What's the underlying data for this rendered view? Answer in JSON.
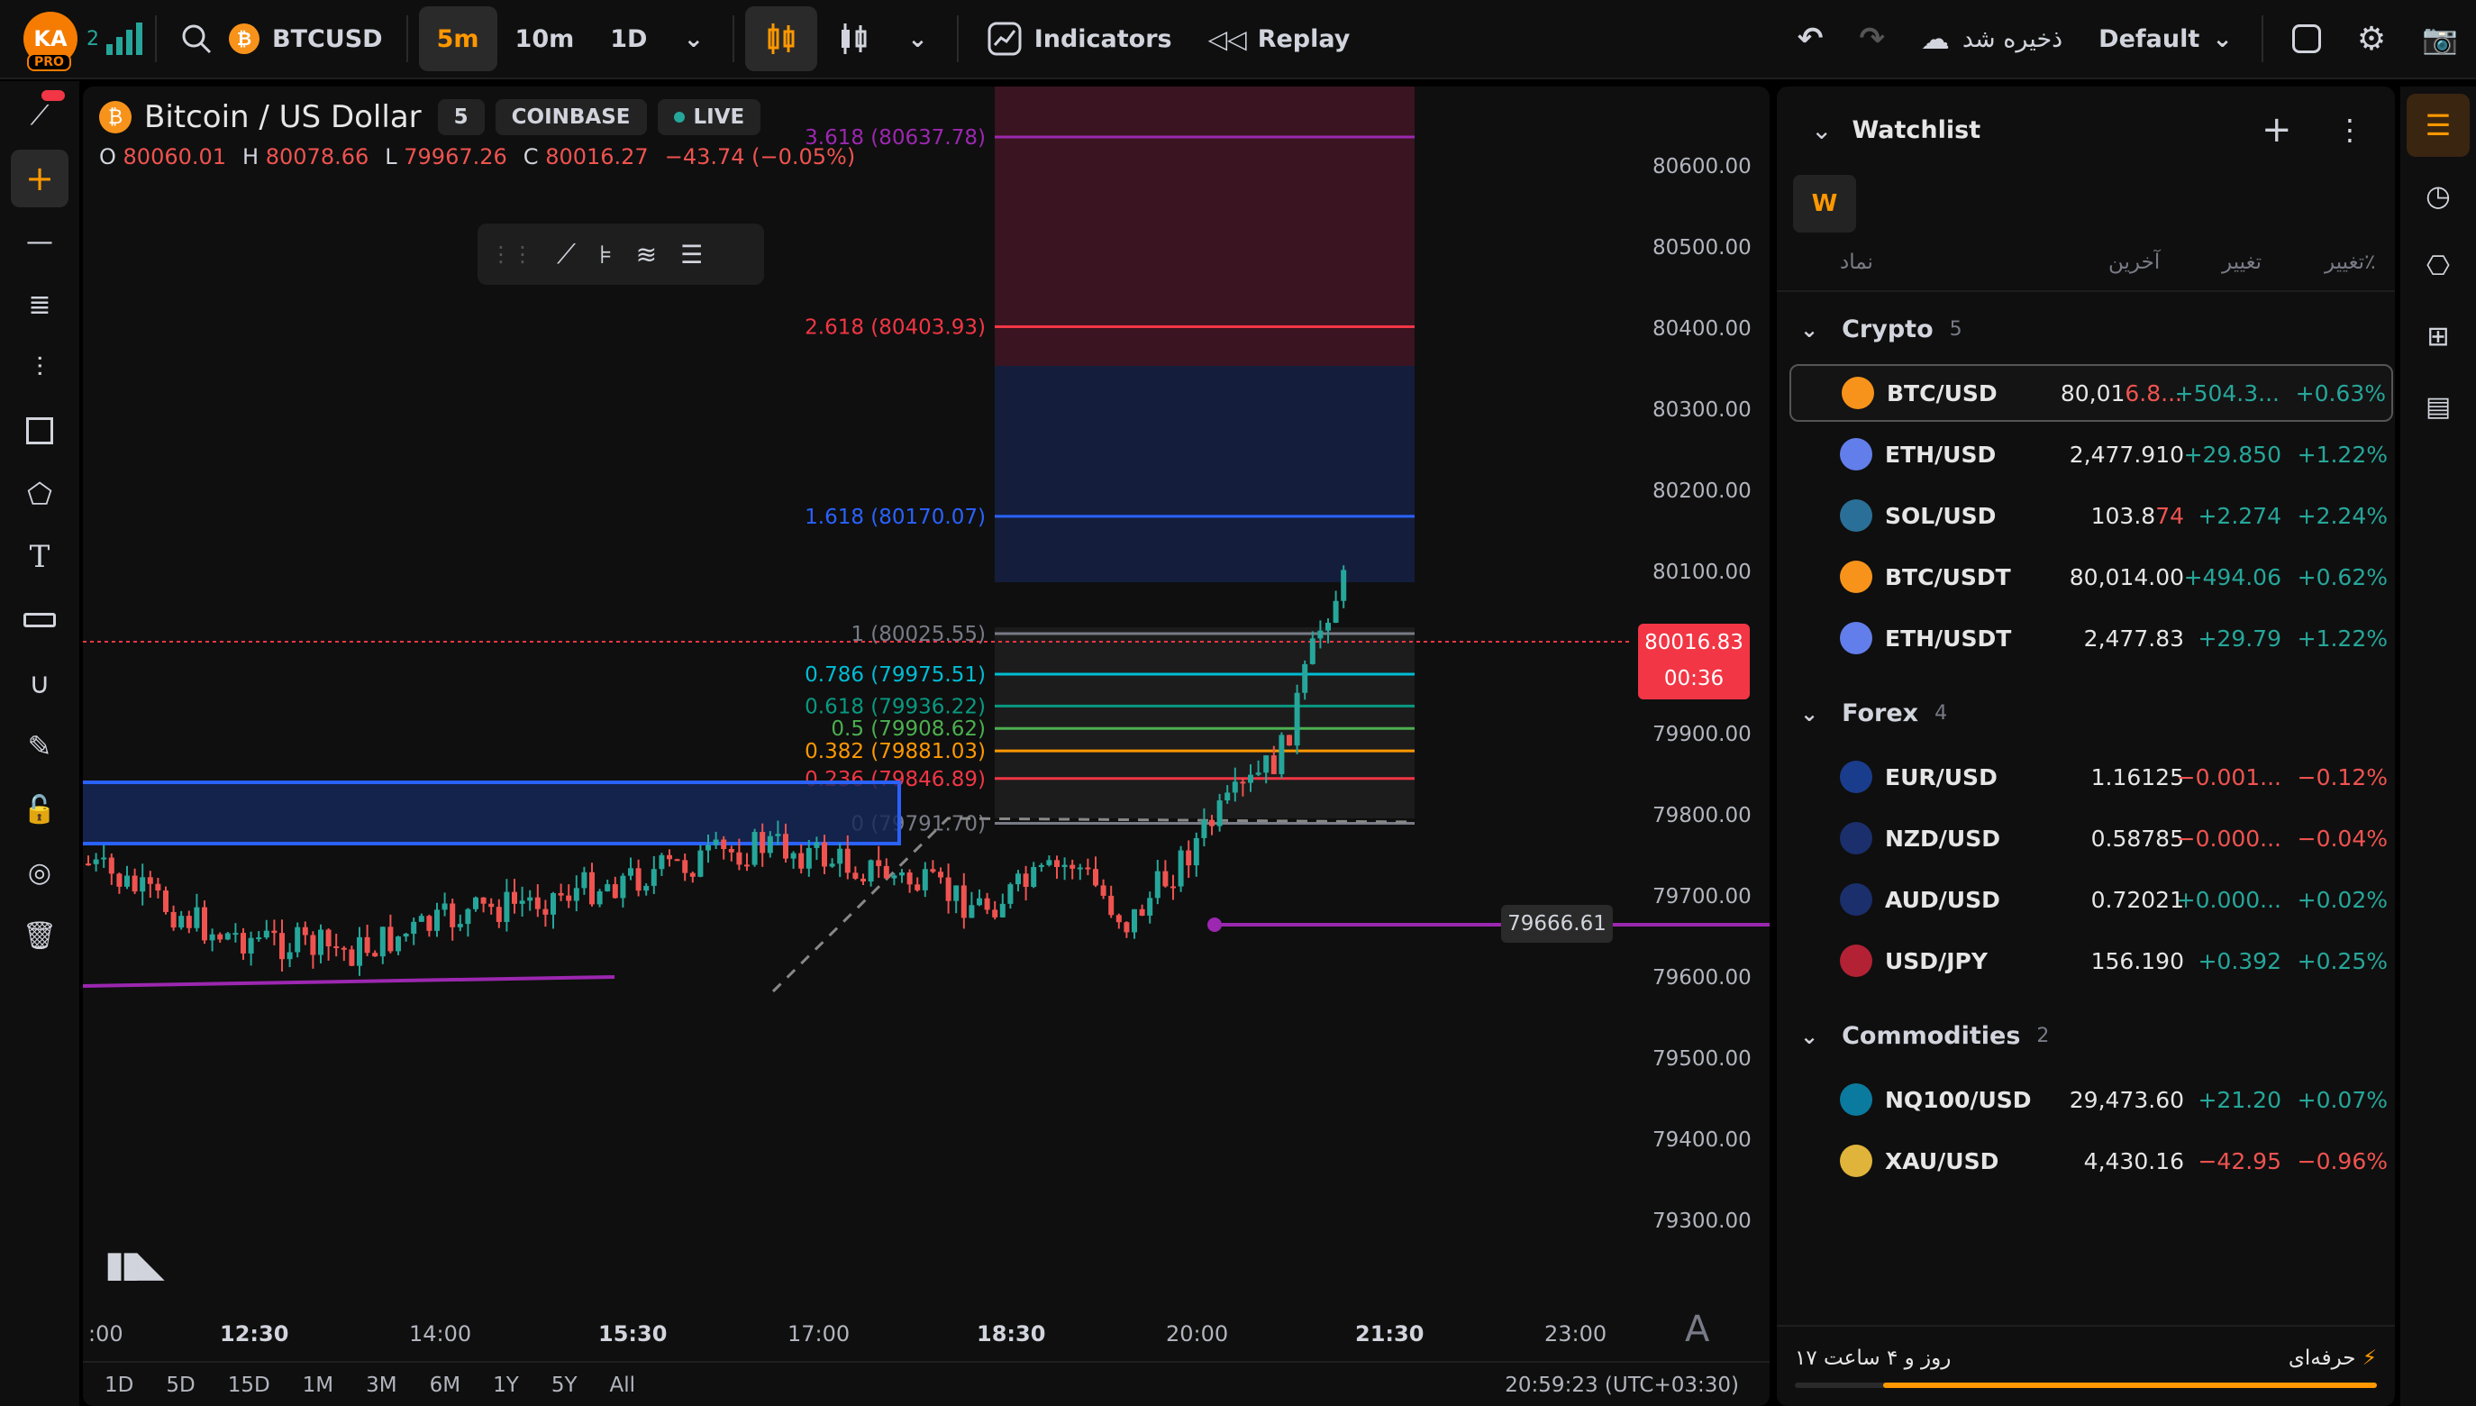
{
  "topbar": {
    "avatar": "KA",
    "avatar_badge": "PRO",
    "signal_count": "2",
    "symbol": "BTCUSD",
    "intervals": [
      "5m",
      "10m",
      "1D"
    ],
    "indicators_label": "Indicators",
    "replay_label": "Replay",
    "saved_label": "ذخیره شد",
    "layout_label": "Default"
  },
  "legend": {
    "title": "Bitcoin / US Dollar",
    "interval": "5",
    "exchange": "COINBASE",
    "live": "LIVE",
    "o_label": "O",
    "o": "80060.01",
    "h_label": "H",
    "h": "80078.66",
    "l_label": "L",
    "l": "79967.26",
    "c_label": "C",
    "c": "80016.27",
    "change": "−43.74 (−0.05%)"
  },
  "price_axis": [
    "80600.00",
    "80500.00",
    "80400.00",
    "80300.00",
    "80200.00",
    "80100.00",
    "79900.00",
    "79800.00",
    "79700.00",
    "79600.00",
    "79500.00",
    "79400.00",
    "79300.00"
  ],
  "time_axis": [
    ":00",
    "12:30",
    "14:00",
    "15:30",
    "17:00",
    "18:30",
    "20:00",
    "21:30",
    "23:00"
  ],
  "last_price": "80016.83",
  "countdown": "00:36",
  "hline_label": "79666.61",
  "fib_levels": [
    {
      "label": "3.618 (80637.78)",
      "color": "#9c27b0"
    },
    {
      "label": "2.618 (80403.93)",
      "color": "#f23645"
    },
    {
      "label": "1.618 (80170.07)",
      "color": "#2962ff"
    },
    {
      "label": "1 (80025.55)",
      "color": "#787b86"
    },
    {
      "label": "0.786 (79975.51)",
      "color": "#00bcd4"
    },
    {
      "label": "0.618 (79936.22)",
      "color": "#089981"
    },
    {
      "label": "0.5 (79908.62)",
      "color": "#4caf50"
    },
    {
      "label": "0.382 (79881.03)",
      "color": "#ff9800"
    },
    {
      "label": "0.236 (79846.89)",
      "color": "#f23645"
    },
    {
      "label": "0 (79791.70)",
      "color": "#787b86"
    }
  ],
  "ranges": [
    "1D",
    "5D",
    "15D",
    "1M",
    "3M",
    "6M",
    "1Y",
    "5Y",
    "All"
  ],
  "clock": "20:59:23 (UTC+03:30)",
  "watchlist": {
    "title": "Watchlist",
    "w_badge": "W",
    "headers": {
      "symbol": "نماد",
      "last": "آخرین",
      "change": "تغییر",
      "pct": "تغییر٪"
    },
    "groups": [
      {
        "name": "Crypto",
        "count": "5",
        "items": [
          {
            "symbol": "BTC/USD",
            "last_a": "80,01",
            "last_b": "6.8...",
            "chg": "+504.3...",
            "pct": "+0.63%",
            "dir": "pos"
          },
          {
            "symbol": "ETH/USD",
            "last_a": "2,477.910",
            "last_b": "",
            "chg": "+29.850",
            "pct": "+1.22%",
            "dir": "pos"
          },
          {
            "symbol": "SOL/USD",
            "last_a": "103.8",
            "last_b": "74",
            "chg": "+2.274",
            "pct": "+2.24%",
            "dir": "pos"
          },
          {
            "symbol": "BTC/USDT",
            "last_a": "80,014.00",
            "last_b": "",
            "chg": "+494.06",
            "pct": "+0.62%",
            "dir": "pos"
          },
          {
            "symbol": "ETH/USDT",
            "last_a": "2,477.83",
            "last_b": "",
            "chg": "+29.79",
            "pct": "+1.22%",
            "dir": "pos"
          }
        ]
      },
      {
        "name": "Forex",
        "count": "4",
        "items": [
          {
            "symbol": "EUR/USD",
            "last_a": "1.16125",
            "last_b": "",
            "chg": "−0.001...",
            "pct": "−0.12%",
            "dir": "neg"
          },
          {
            "symbol": "NZD/USD",
            "last_a": "0.58785",
            "last_b": "",
            "chg": "−0.000...",
            "pct": "−0.04%",
            "dir": "neg"
          },
          {
            "symbol": "AUD/USD",
            "last_a": "0.72021",
            "last_b": "",
            "chg": "+0.000...",
            "pct": "+0.02%",
            "dir": "pos"
          },
          {
            "symbol": "USD/JPY",
            "last_a": "156.190",
            "last_b": "",
            "chg": "+0.392",
            "pct": "+0.25%",
            "dir": "pos"
          }
        ]
      },
      {
        "name": "Commodities",
        "count": "2",
        "items": [
          {
            "symbol": "NQ100/USD",
            "last_a": "29,473.60",
            "last_b": "",
            "chg": "+21.20",
            "pct": "+0.07%",
            "dir": "pos"
          },
          {
            "symbol": "XAU/USD",
            "last_a": "4,430.16",
            "last_b": "",
            "chg": "−42.95",
            "pct": "−0.96%",
            "dir": "neg"
          }
        ]
      }
    ],
    "footer_left": "۱۷ روز و ۴ ساعت",
    "footer_right": "حرفه‌ای"
  },
  "colors": {
    "up": "#26a69a",
    "down": "#ef5350",
    "accent": "#ff9800",
    "bg": "#0f0f0f"
  }
}
